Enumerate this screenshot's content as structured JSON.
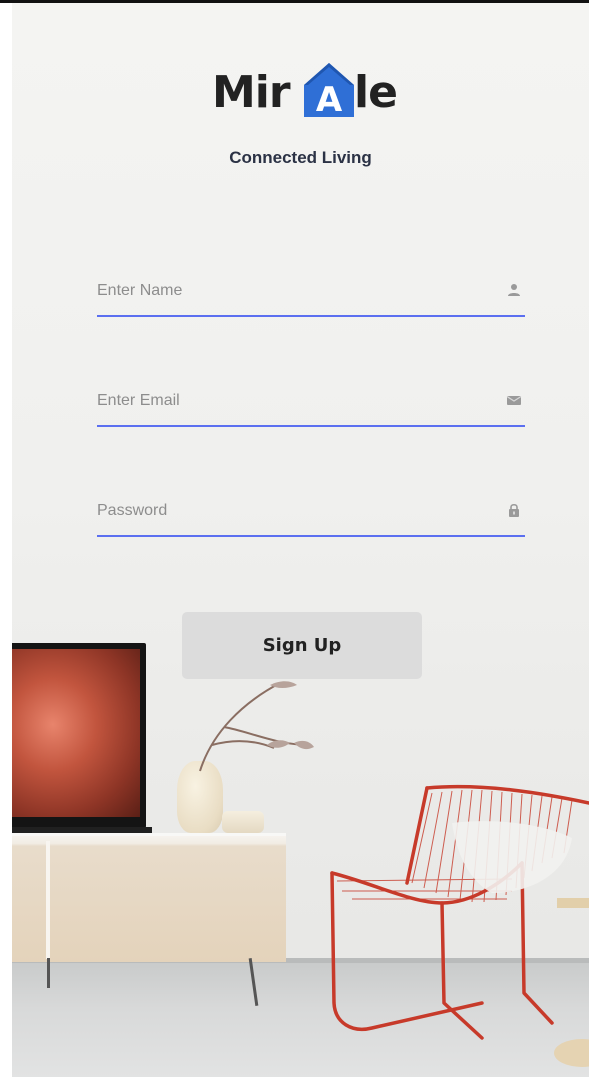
{
  "app": {
    "logo_left": "Mir",
    "logo_right": "le",
    "logo_house_letter": "A",
    "tagline": "Connected Living",
    "brand_color": "#2f6fd6"
  },
  "form": {
    "name_placeholder": "Enter Name",
    "email_placeholder": "Enter Email",
    "password_placeholder": "Password",
    "name_icon": "user-icon",
    "email_icon": "mail-icon",
    "password_icon": "lock-icon",
    "underline_color": "#5b6ff0"
  },
  "actions": {
    "signup_label": "Sign Up"
  }
}
